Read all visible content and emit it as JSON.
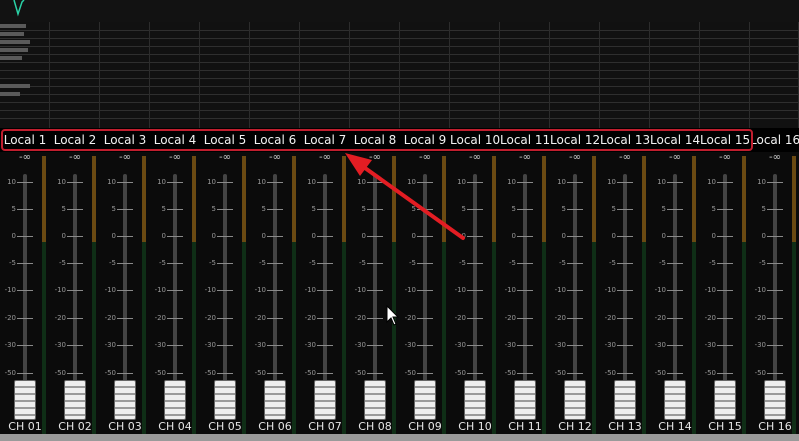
{
  "colors": {
    "highlight": "#c01e2e",
    "arrow": "#e31d23",
    "meter_amber": "#6b4a12",
    "meter_green": "#0f2e16",
    "eq_trace": "#2ad1a6"
  },
  "mixer": {
    "input_labels": [
      "Local 1",
      "Local 2",
      "Local 3",
      "Local 4",
      "Local 5",
      "Local 6",
      "Local 7",
      "Local 8",
      "Local 9",
      "Local 10",
      "Local 11",
      "Local 12",
      "Local 13",
      "Local 14",
      "Local 15",
      "Local 16"
    ],
    "channel_names": [
      "CH 01",
      "CH 02",
      "CH 03",
      "CH 04",
      "CH 05",
      "CH 06",
      "CH 07",
      "CH 08",
      "CH 09",
      "CH 10",
      "CH 11",
      "CH 12",
      "CH 13",
      "CH 14",
      "CH 15",
      "CH 16"
    ],
    "level_readout": "-∞",
    "scale": [
      "10",
      "5",
      "0",
      "-5",
      "-10",
      "-20",
      "-30",
      "-50"
    ]
  },
  "icons": {
    "pointer": "arrow-cursor-icon",
    "annotation": "red-arrow-icon"
  }
}
